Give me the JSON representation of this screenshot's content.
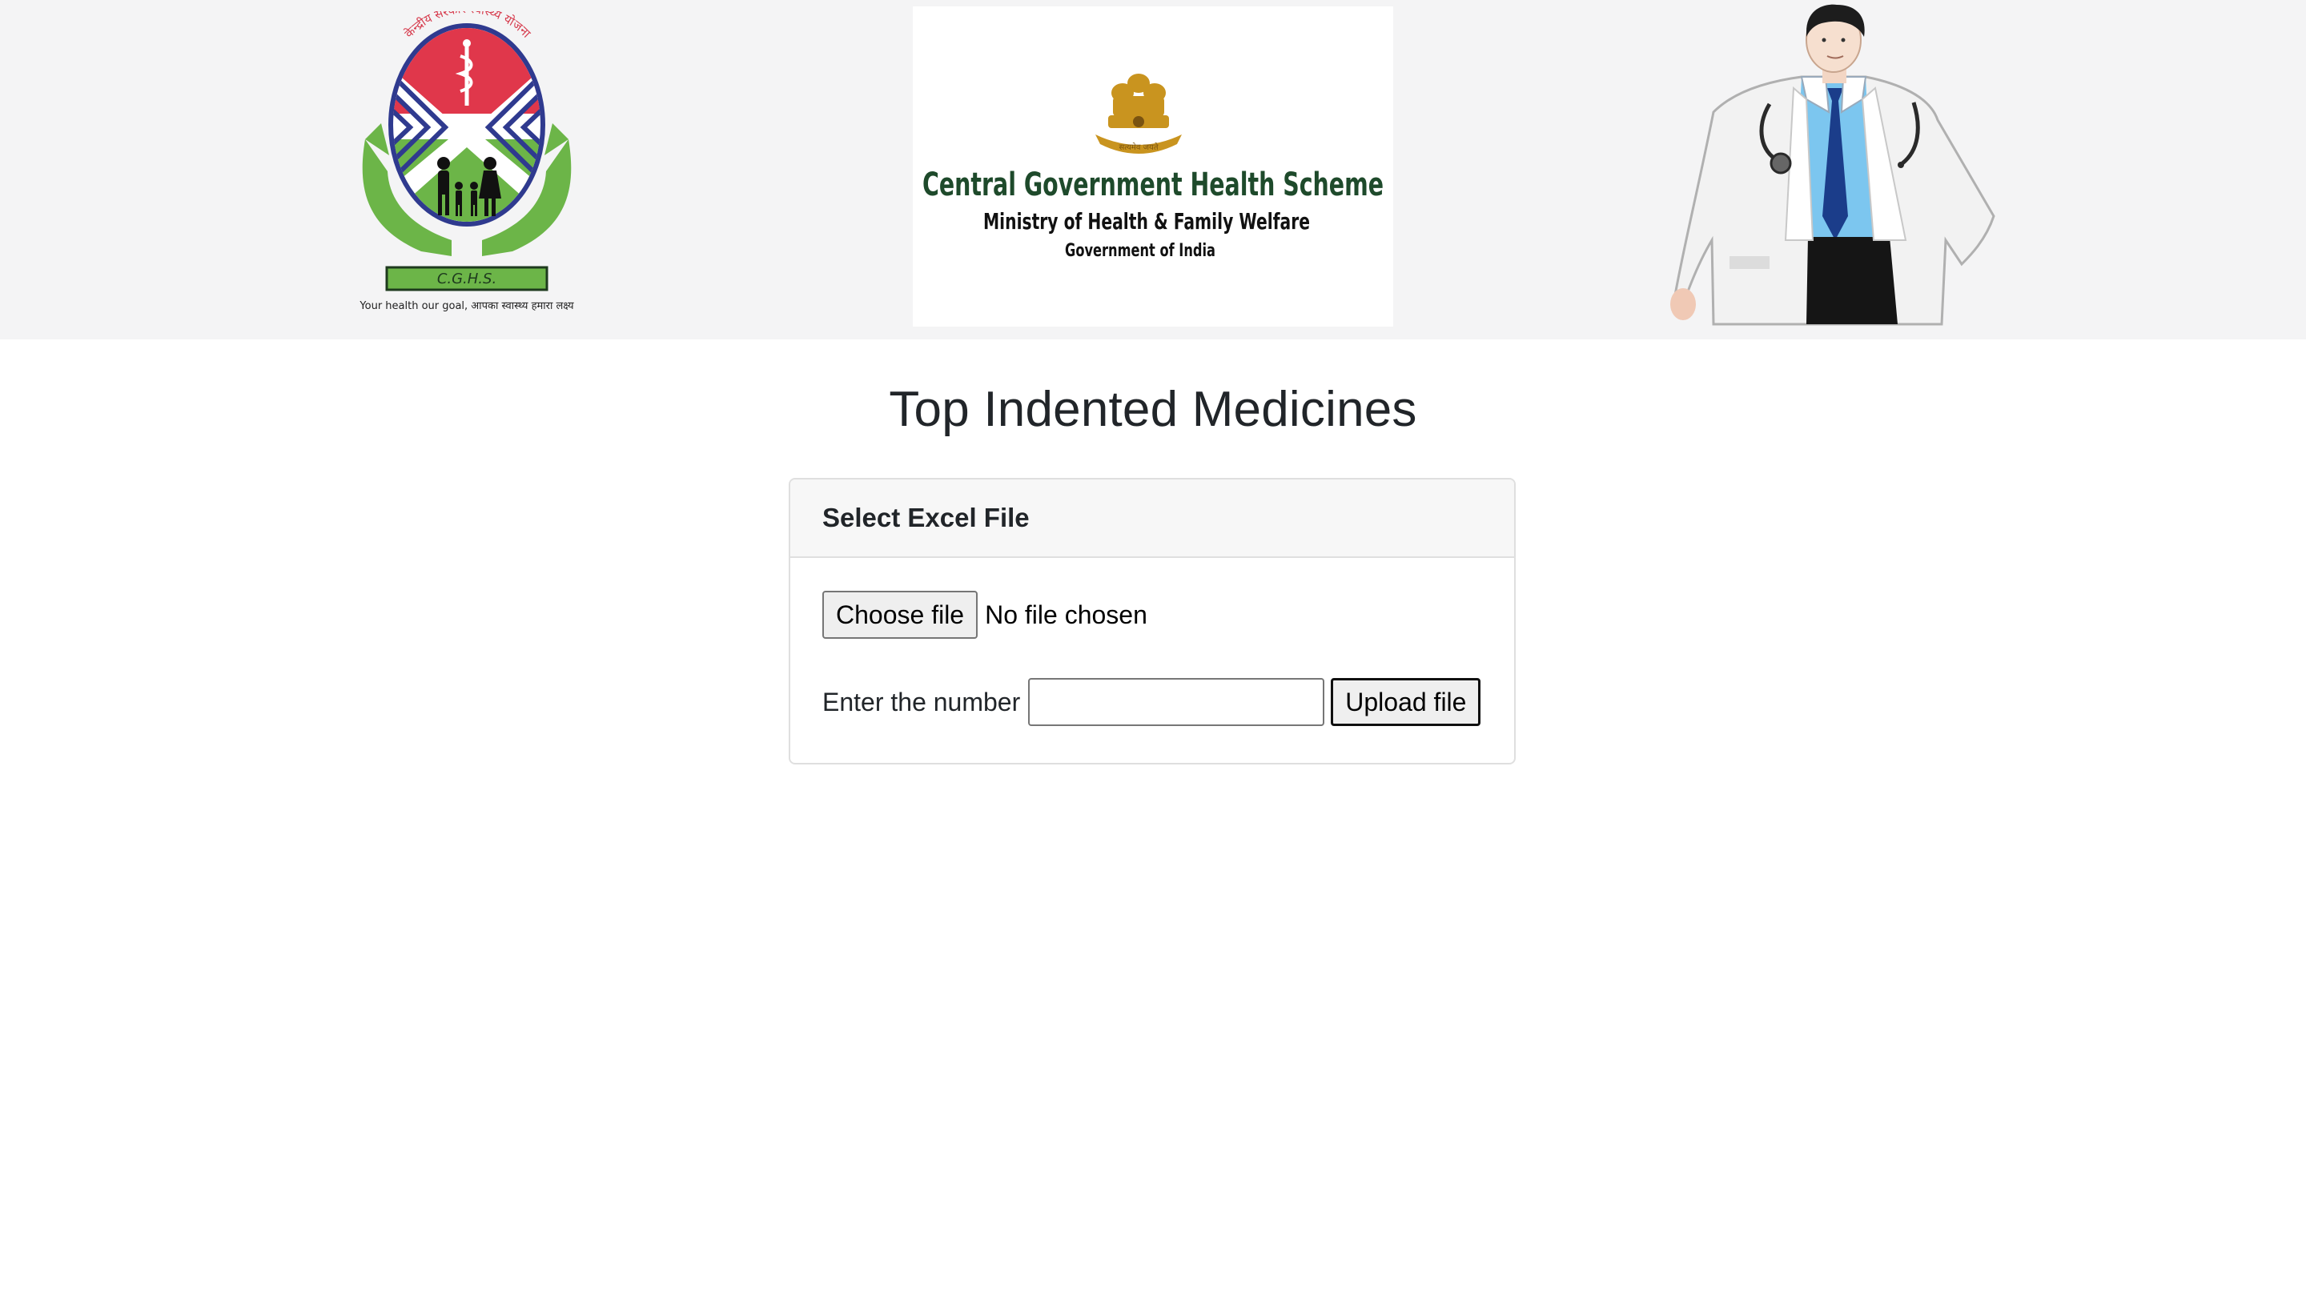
{
  "header": {
    "cghs_logo": {
      "badge_text": "C.G.H.S.",
      "tagline": "Your health our goal, आपका स्वास्थ्य हमारा लक्ष्य",
      "arc_text": "केन्द्रीय सरकार स्वास्थ्य योजना",
      "colors": {
        "red": "#e0374b",
        "blue": "#2f3a8f",
        "green": "#6cb548"
      }
    },
    "ministry_logo": {
      "title": "Central Government Health Scheme",
      "subtitle": "Ministry of Health & Family Welfare",
      "subsubtitle": "Government of India",
      "emblem_caption": "सत्यमेव जयते",
      "colors": {
        "title": "#1e4a2b",
        "emblem": "#c9941f"
      }
    },
    "doctor_illustration": {
      "icon": "doctor-illustration"
    }
  },
  "page": {
    "title": "Top Indented Medicines"
  },
  "upload_card": {
    "header": "Select Excel File",
    "choose_file_label": "Choose file",
    "no_file_text": "No file chosen",
    "number_label": "Enter the number",
    "number_value": "",
    "number_placeholder": "",
    "upload_label": "Upload file"
  }
}
